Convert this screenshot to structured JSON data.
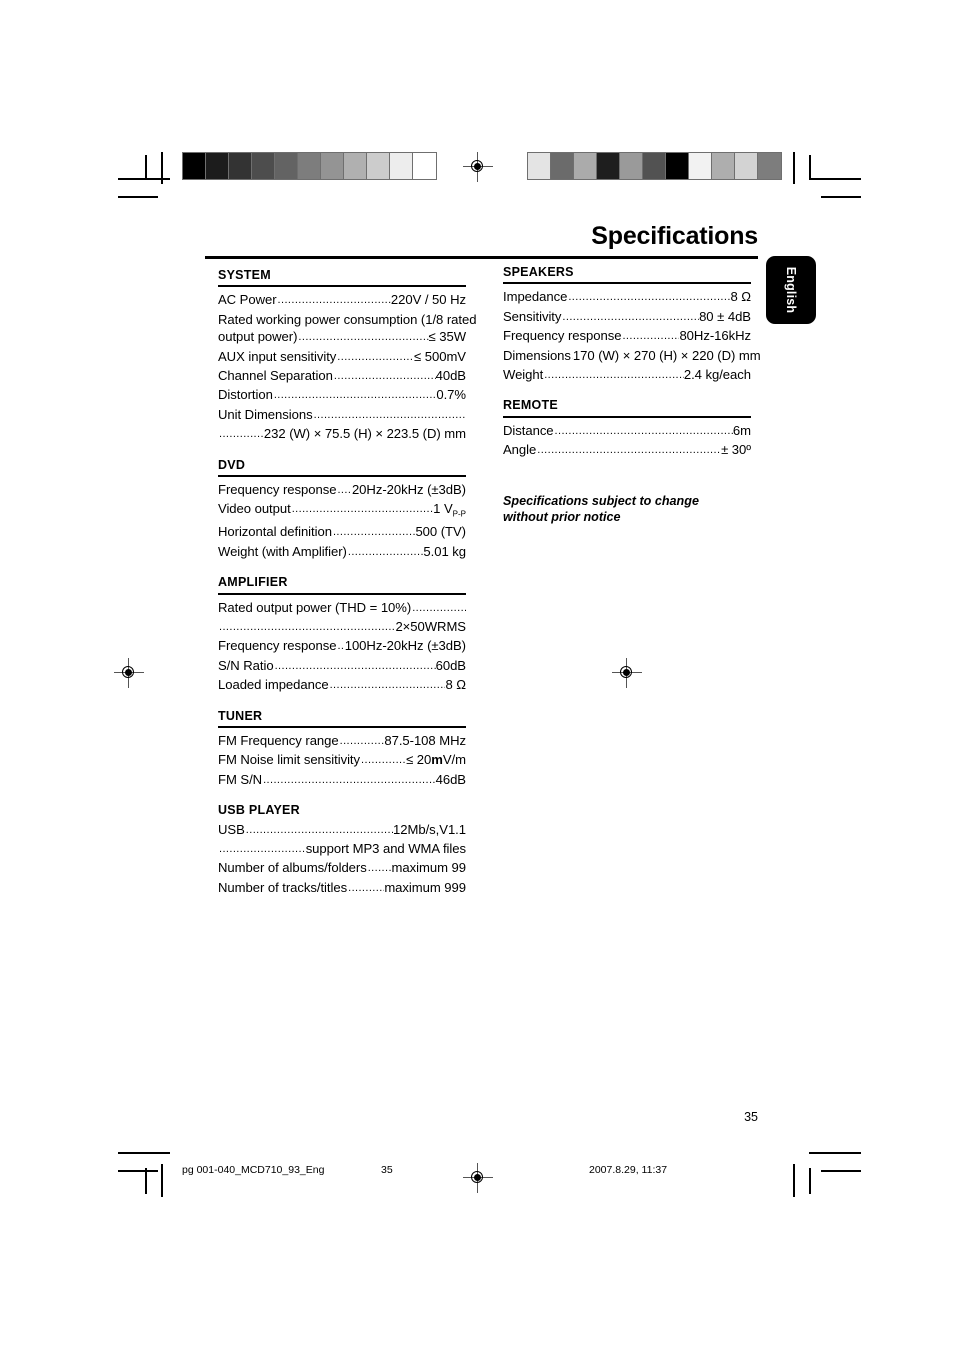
{
  "document": {
    "title": "Specifications",
    "language_tab": "English",
    "page_number": "35"
  },
  "calibration": {
    "left_bar": [
      "#000000",
      "#1c1c1c",
      "#333333",
      "#4d4d4d",
      "#636363",
      "#7d7d7d",
      "#949494",
      "#b0b0b0",
      "#cccccc",
      "#ededed",
      "#ffffff"
    ],
    "right_bar": [
      "#e4e4e4",
      "#6b6b6b",
      "#ababab",
      "#1e1e1e",
      "#9a9a9a",
      "#525252",
      "#000000",
      "#f2f2f2",
      "#aeaeae",
      "#d3d3d3",
      "#7d7d7d"
    ]
  },
  "left_column": [
    {
      "heading": "SYSTEM",
      "rows": [
        {
          "label": "AC Power",
          "value": "220V / 50 Hz",
          "dotted": true
        },
        {
          "label": "Rated working power consumption (1/8 rated",
          "value": "",
          "dotted": false
        },
        {
          "label": "output power)",
          "value": "≤ 35W",
          "dotted": true
        },
        {
          "label": "AUX input sensitivity",
          "value": "≤ 500mV",
          "dotted": true
        },
        {
          "label": "Channel Separation",
          "value": "40dB",
          "dotted": true
        },
        {
          "label": "Distortion",
          "value": "0.7%",
          "dotted": true
        },
        {
          "label": "Unit Dimensions",
          "value": "",
          "dotted": true
        },
        {
          "label": "",
          "value": "232 (W) × 75.5 (H) × 223.5 (D) mm",
          "dotted": true,
          "lead_dots": true
        }
      ]
    },
    {
      "heading": "DVD",
      "rows": [
        {
          "label": "Frequency response",
          "value": "20Hz-20kHz (±3dB)",
          "dotted": true
        },
        {
          "label": "Video output",
          "value": "1 V",
          "value_sub": "P-P",
          "dotted": true
        },
        {
          "label": "Horizontal definition",
          "value": "500 (TV)",
          "dotted": true
        },
        {
          "label": "Weight (with Amplifier)",
          "value": "5.01 kg",
          "dotted": true
        }
      ]
    },
    {
      "heading": "AMPLIFIER",
      "rows": [
        {
          "label": "Rated output power (THD = 10%)",
          "value": "",
          "dotted": true
        },
        {
          "label": "",
          "value": "2×50WRMS",
          "dotted": true,
          "lead_dots": true
        },
        {
          "label": "Frequency response",
          "value": "100Hz-20kHz (±3dB)",
          "dotted": true
        },
        {
          "label": "S/N Ratio",
          "value": "60dB",
          "dotted": true
        },
        {
          "label": "Loaded impedance",
          "value": "8 Ω",
          "dotted": true
        }
      ]
    },
    {
      "heading": "TUNER",
      "rows": [
        {
          "label": "FM Frequency range",
          "value": "87.5-108 MHz",
          "dotted": true
        },
        {
          "label": "FM Noise limit sensitivity",
          "value": "≤ 20mV/m",
          "value_bold_part": "m",
          "dotted": true
        },
        {
          "label": "FM S/N",
          "value": "46dB",
          "dotted": true
        }
      ]
    },
    {
      "heading": "USB PLAYER",
      "no_rule": true,
      "rows": [
        {
          "label": "USB",
          "value": "12Mb/s,V1.1",
          "dotted": true
        },
        {
          "label": "",
          "value": "support MP3 and WMA files",
          "dotted": true,
          "lead_dots": true
        },
        {
          "label": "Number of albums/folders",
          "value": "maximum 99",
          "dotted": true
        },
        {
          "label": "Number of tracks/titles",
          "value": "maximum 999",
          "dotted": true
        }
      ]
    }
  ],
  "right_column": [
    {
      "heading": "SPEAKERS",
      "rows": [
        {
          "label": "Impedance",
          "value": "8 Ω",
          "dotted": true
        },
        {
          "label": "Sensitivity",
          "value": "80 ± 4dB",
          "dotted": true
        },
        {
          "label": "Frequency response",
          "value": "80Hz-16kHz",
          "dotted": true
        },
        {
          "label": "Dimensions",
          "value": "170 (W) × 270 (H) × 220 (D) mm",
          "dotted": true,
          "short_dots": true
        },
        {
          "label": "Weight",
          "value": "2.4 kg/each",
          "dotted": true
        }
      ]
    },
    {
      "heading": "REMOTE",
      "rows": [
        {
          "label": "Distance",
          "value": "6m",
          "dotted": true
        },
        {
          "label": "Angle",
          "value": "± 30º",
          "dotted": true
        }
      ]
    }
  ],
  "note": "Specifications subject to change without prior notice",
  "footer": {
    "file_slug": "pg 001-040_MCD710_93_Eng",
    "page_slug": "35",
    "date_slug": "2007.8.29, 11:37"
  }
}
